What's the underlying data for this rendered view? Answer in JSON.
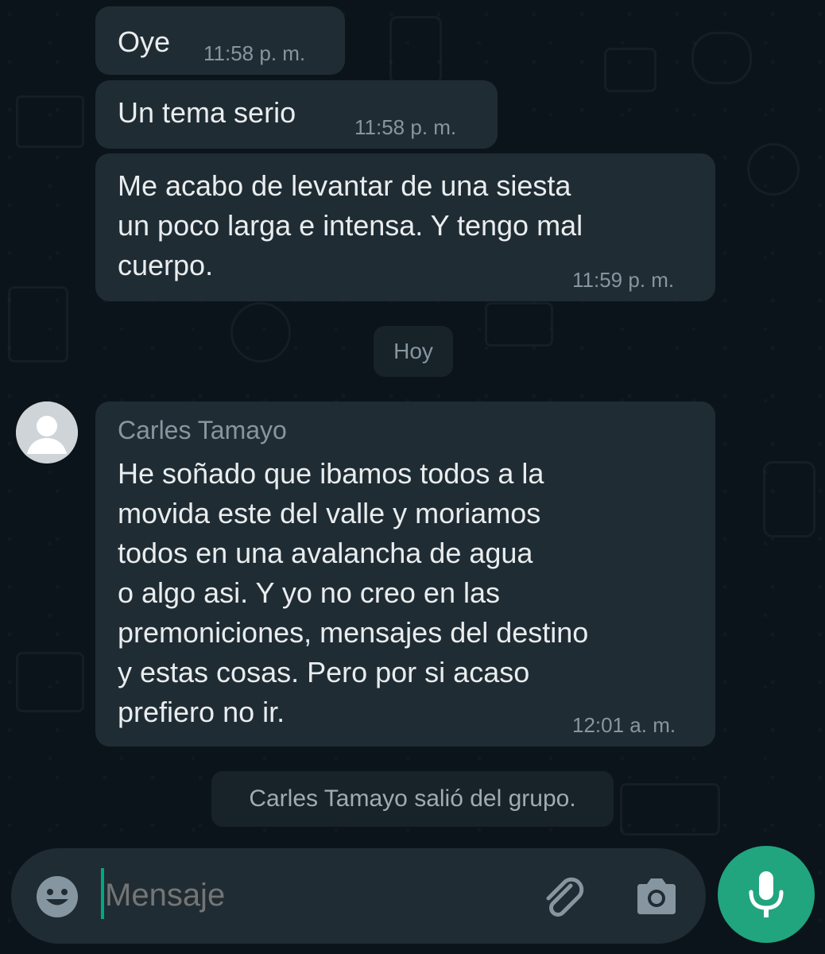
{
  "messages": [
    {
      "text": "Oye",
      "time": "11:58 p. m."
    },
    {
      "text": "Un tema serio",
      "time": "11:58 p. m."
    },
    {
      "text": "Me acabo de levantar de una siesta\nun poco larga e intensa. Y tengo mal\ncuerpo.",
      "time": "11:59 p. m."
    },
    {
      "sender": "Carles Tamayo",
      "text": "He soñado que ibamos todos a la\nmovida este del valle y moriamos\ntodos en una avalancha de agua\no algo asi. Y yo no creo en las\npremoniciones, mensajes del destino\ny estas cosas. Pero por si acaso\nprefiero no ir.",
      "time": "12:01 a. m."
    }
  ],
  "date_divider": "Hoy",
  "system_message": "Carles Tamayo salió del grupo.",
  "composer": {
    "placeholder": "Mensaje",
    "emoji_icon": "emoji-icon",
    "attach_icon": "paperclip-icon",
    "camera_icon": "camera-icon",
    "mic_icon": "microphone-icon"
  },
  "colors": {
    "background": "#0b141a",
    "bubble": "#202c33",
    "accent": "#21a57f",
    "text": "#e9edef",
    "muted": "#8696a0"
  }
}
